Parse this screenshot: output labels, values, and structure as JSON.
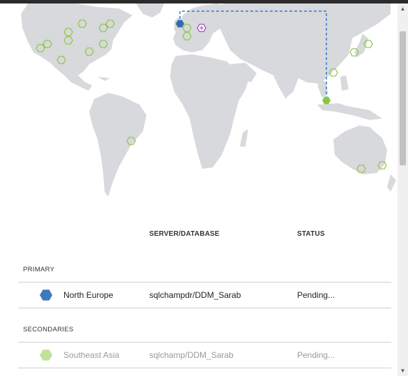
{
  "colors": {
    "land": "#d7d9dc",
    "primary_hex": "#2e6db4",
    "secondary_hex": "#8cc63f",
    "region_outline": "#8dc63f",
    "link_line": "#2e7bd1",
    "selection": "#9a3fb4"
  },
  "table": {
    "col_server": "SERVER/DATABASE",
    "col_status": "STATUS",
    "primary_label": "PRIMARY",
    "secondaries_label": "SECONDARIES",
    "primary": {
      "region": "North Europe",
      "server": "sqlchampdr/DDM_Sarab",
      "status": "Pending..."
    },
    "secondaries": [
      {
        "region": "Southeast Asia",
        "server": "sqlchamp/DDM_Sarab",
        "status": "Pending..."
      }
    ]
  },
  "icons": {
    "primary": "hexagon-filled-striped-icon",
    "secondary": "hexagon-filled-striped-icon",
    "region": "hexagon-outline-icon",
    "target": "plus-hexagon-icon",
    "scroll_up": "chevron-up-icon",
    "scroll_down": "chevron-down-icon"
  },
  "scrollbar": {
    "up_glyph": "▲",
    "down_glyph": "▼"
  }
}
